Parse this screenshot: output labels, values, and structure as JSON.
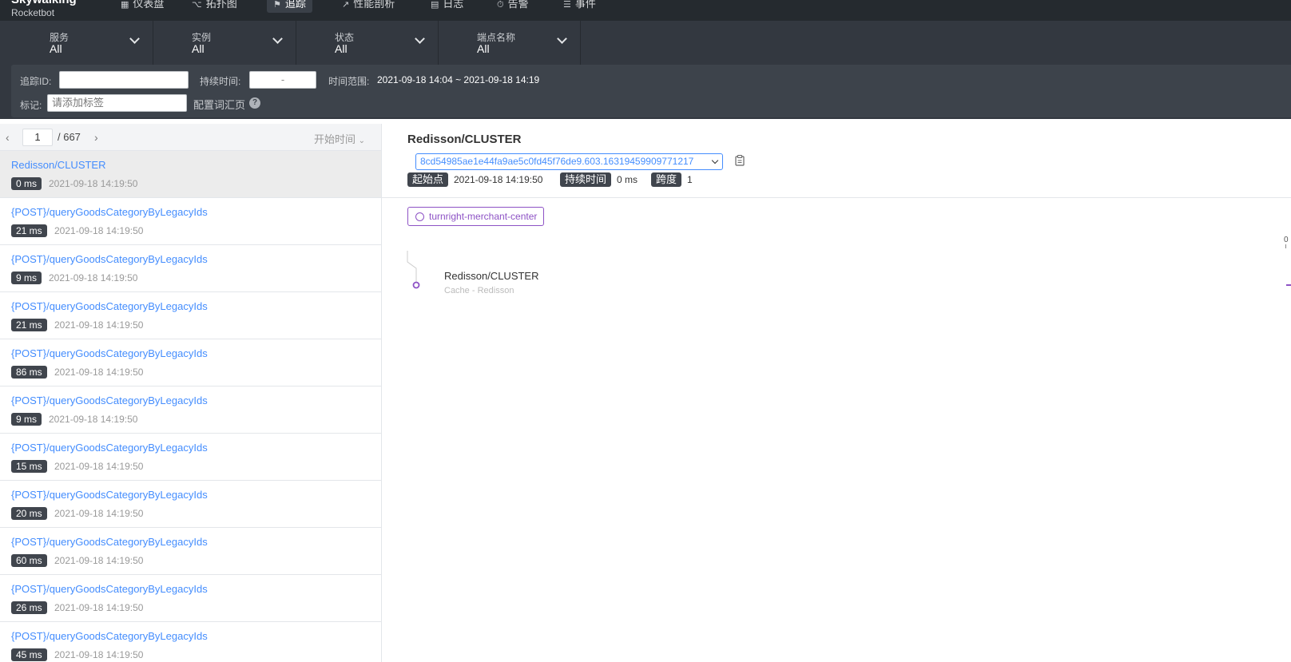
{
  "nav": {
    "brand_title": "Skywalking",
    "brand_sub": "Rocketbot",
    "items": [
      {
        "label": "仪表盘",
        "icon": "dashboard-icon"
      },
      {
        "label": "拓扑图",
        "icon": "topology-icon"
      },
      {
        "label": "追踪",
        "icon": "trace-icon",
        "active": true
      },
      {
        "label": "性能剖析",
        "icon": "profile-icon"
      },
      {
        "label": "日志",
        "icon": "log-icon"
      },
      {
        "label": "告警",
        "icon": "alarm-icon"
      },
      {
        "label": "事件",
        "icon": "event-icon"
      }
    ]
  },
  "selectors": [
    {
      "label": "服务",
      "value": "All"
    },
    {
      "label": "实例",
      "value": "All"
    },
    {
      "label": "状态",
      "value": "All"
    },
    {
      "label": "端点名称",
      "value": "All"
    }
  ],
  "filter": {
    "trace_id_label": "追踪ID:",
    "trace_id_value": "",
    "duration_label": "持续时间:",
    "duration_value": "-",
    "time_range_label": "时间范围:",
    "time_range_value": "2021-09-18 14:04 ~ 2021-09-18 14:19",
    "tags_label": "标记:",
    "tags_placeholder": "请添加标签",
    "vocab_link": "配置词汇页"
  },
  "list": {
    "page": "1",
    "total": "/ 667",
    "sort_label": "开始时间",
    "items": [
      {
        "name": "Redisson/CLUSTER",
        "duration": "0 ms",
        "time": "2021-09-18 14:19:50",
        "active": true
      },
      {
        "name": "{POST}/queryGoodsCategoryByLegacyIds",
        "duration": "21 ms",
        "time": "2021-09-18 14:19:50"
      },
      {
        "name": "{POST}/queryGoodsCategoryByLegacyIds",
        "duration": "9 ms",
        "time": "2021-09-18 14:19:50"
      },
      {
        "name": "{POST}/queryGoodsCategoryByLegacyIds",
        "duration": "21 ms",
        "time": "2021-09-18 14:19:50"
      },
      {
        "name": "{POST}/queryGoodsCategoryByLegacyIds",
        "duration": "86 ms",
        "time": "2021-09-18 14:19:50"
      },
      {
        "name": "{POST}/queryGoodsCategoryByLegacyIds",
        "duration": "9 ms",
        "time": "2021-09-18 14:19:50"
      },
      {
        "name": "{POST}/queryGoodsCategoryByLegacyIds",
        "duration": "15 ms",
        "time": "2021-09-18 14:19:50"
      },
      {
        "name": "{POST}/queryGoodsCategoryByLegacyIds",
        "duration": "20 ms",
        "time": "2021-09-18 14:19:50"
      },
      {
        "name": "{POST}/queryGoodsCategoryByLegacyIds",
        "duration": "60 ms",
        "time": "2021-09-18 14:19:50"
      },
      {
        "name": "{POST}/queryGoodsCategoryByLegacyIds",
        "duration": "26 ms",
        "time": "2021-09-18 14:19:50"
      },
      {
        "name": "{POST}/queryGoodsCategoryByLegacyIds",
        "duration": "45 ms",
        "time": "2021-09-18 14:19:50"
      }
    ]
  },
  "detail": {
    "title": "Redisson/CLUSTER",
    "trace_id": "8cd54985ae1e44fa9ae5c0fd45f76de9.603.16319459909771217",
    "start_label": "起始点",
    "start_value": "2021-09-18 14:19:50",
    "duration_label": "持续时间",
    "duration_value": "0 ms",
    "span_label": "跨度",
    "span_value": "1",
    "service": "turnright-merchant-center",
    "span_name": "Redisson/CLUSTER",
    "span_sub": "Cache - Redisson",
    "axis_zero": "0"
  },
  "colors": {
    "link": "#448dfe",
    "service_purple": "#8d52c5",
    "nav_bg": "#252a2f",
    "bar_bg": "#333840"
  }
}
